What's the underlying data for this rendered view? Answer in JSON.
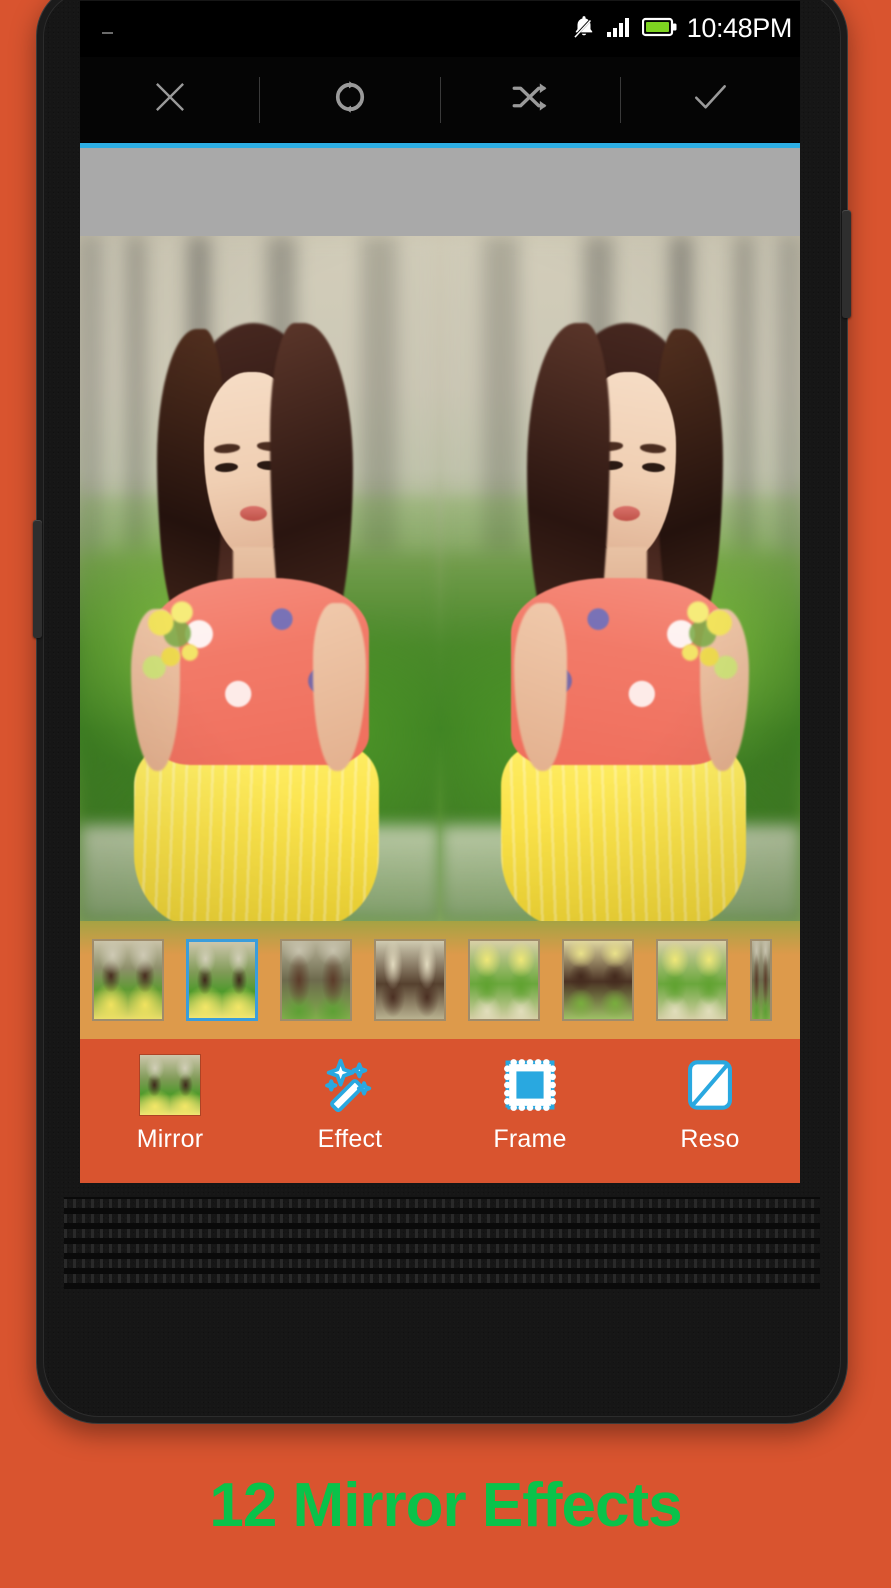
{
  "promo": {
    "caption": "12 Mirror Effects",
    "caption_color": "#0ac24a",
    "background_color": "#d9542f"
  },
  "status_bar": {
    "time": "10:48PM",
    "icons": [
      "bell-muted-icon",
      "signal-bars-icon",
      "battery-icon"
    ],
    "battery_color": "#7ed321",
    "background_color": "#000000"
  },
  "action_bar": {
    "buttons": [
      {
        "name": "close-button",
        "icon": "close-x-icon"
      },
      {
        "name": "rotate-button",
        "icon": "rotate-refresh-icon"
      },
      {
        "name": "shuffle-button",
        "icon": "shuffle-icon"
      },
      {
        "name": "confirm-button",
        "icon": "check-icon"
      }
    ],
    "icon_color": "#9a9a9a"
  },
  "ad_banner": {
    "accent_color": "#2eaee3",
    "background_color": "#a9a9a9"
  },
  "photo_canvas": {
    "description": "mirrored photo of woman in floral top and yellow skirt holding flowers in a garden",
    "mirror_axis": "vertical"
  },
  "thumb_strip": {
    "background_color": "#dd9a4b",
    "selected_index": 1,
    "selected_border_color": "#3a9ddb",
    "thumbnails": [
      {
        "name": "mirror-preset-1",
        "variant": "ta"
      },
      {
        "name": "mirror-preset-2",
        "variant": "ta v2"
      },
      {
        "name": "mirror-preset-3",
        "variant": "ta v3"
      },
      {
        "name": "mirror-preset-4",
        "variant": "ta v4"
      },
      {
        "name": "mirror-preset-5",
        "variant": "ta v5"
      },
      {
        "name": "mirror-preset-6",
        "variant": "ta v6"
      },
      {
        "name": "mirror-preset-7",
        "variant": "ta v5"
      },
      {
        "name": "mirror-preset-8",
        "variant": "ta v3"
      }
    ]
  },
  "tool_bar": {
    "background_color": "#d9542f",
    "label_color": "#ffffff",
    "icon_accent_color": "#29a8e0",
    "tools": [
      {
        "label": "Mirror",
        "icon": "mirror-thumbnail-icon"
      },
      {
        "label": "Effect",
        "icon": "magic-wand-icon"
      },
      {
        "label": "Frame",
        "icon": "stamp-frame-icon"
      },
      {
        "label": "Reso",
        "icon": "resolution-icon"
      }
    ]
  }
}
